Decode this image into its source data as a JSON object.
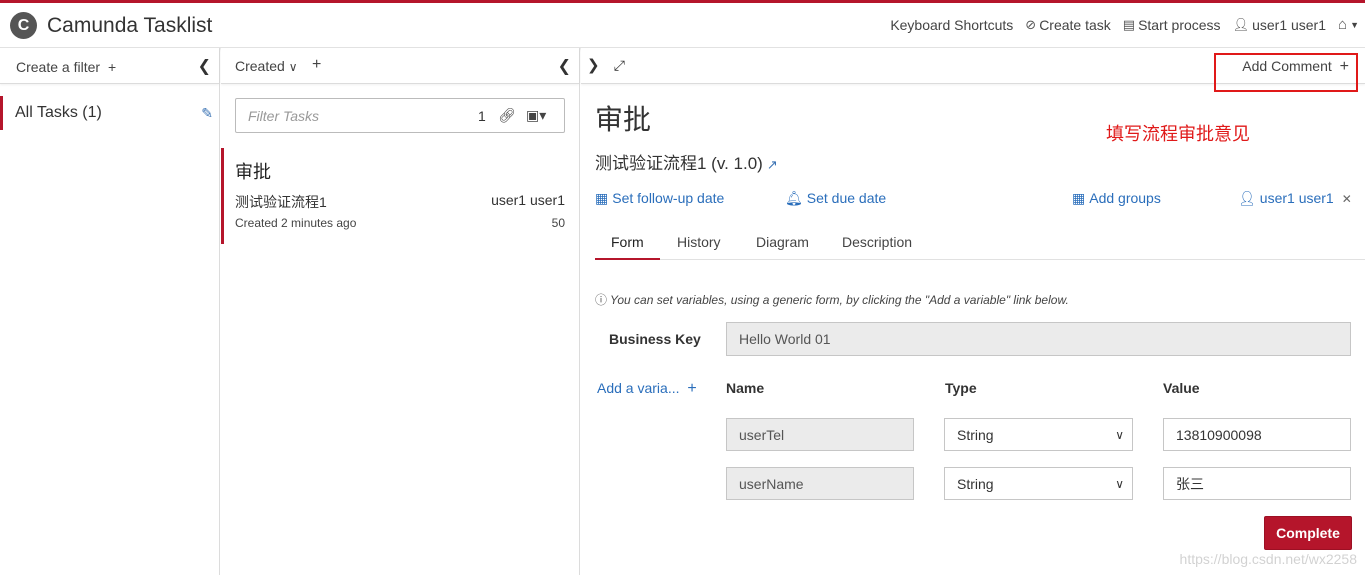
{
  "header": {
    "brand_logo": "C",
    "title": "Camunda Tasklist",
    "nav": {
      "keyboard_shortcuts": "Keyboard Shortcuts",
      "create_task": "Create task",
      "start_process": "Start process",
      "user": "user1 user1"
    },
    "icons": {
      "create_task": "paperclip-icon",
      "start_process": "list-icon",
      "user": "user-icon",
      "home": "home-icon"
    }
  },
  "filters": {
    "create_filter": "Create a filter",
    "items": [
      {
        "label": "All Tasks (1)"
      }
    ]
  },
  "task_list": {
    "sort_label": "Created",
    "filter_placeholder": "Filter Tasks",
    "filter_count": "1",
    "tasks": [
      {
        "name": "审批",
        "process": "测试验证流程1",
        "assignee": "user1 user1",
        "created": "Created 2 minutes ago",
        "priority": "50"
      }
    ]
  },
  "detail": {
    "add_comment": "Add Comment",
    "task_name": "审批",
    "annotation": "填写流程审批意见",
    "process_definition": "测试验证流程1 (v. 1.0)",
    "actions": {
      "follow_up": "Set follow-up date",
      "due_date": "Set due date",
      "groups": "Add groups",
      "assignee": "user1 user1"
    },
    "tabs": [
      "Form",
      "History",
      "Diagram",
      "Description"
    ],
    "active_tab": "Form",
    "form": {
      "info": "You can set variables, using a generic form, by clicking the \"Add a variable\" link below.",
      "business_key_label": "Business Key",
      "business_key_value": "Hello World 01",
      "add_variable": "Add a varia...",
      "columns": {
        "name": "Name",
        "type": "Type",
        "value": "Value"
      },
      "variables": [
        {
          "name": "userTel",
          "type": "String",
          "value": "13810900098"
        },
        {
          "name": "userName",
          "type": "String",
          "value": "张三"
        }
      ],
      "complete": "Complete"
    }
  },
  "watermark": "https://blog.csdn.net/wx2258",
  "colors": {
    "brand": "#b5152b",
    "link": "#2a6ebb",
    "annotation": "#e01919"
  }
}
